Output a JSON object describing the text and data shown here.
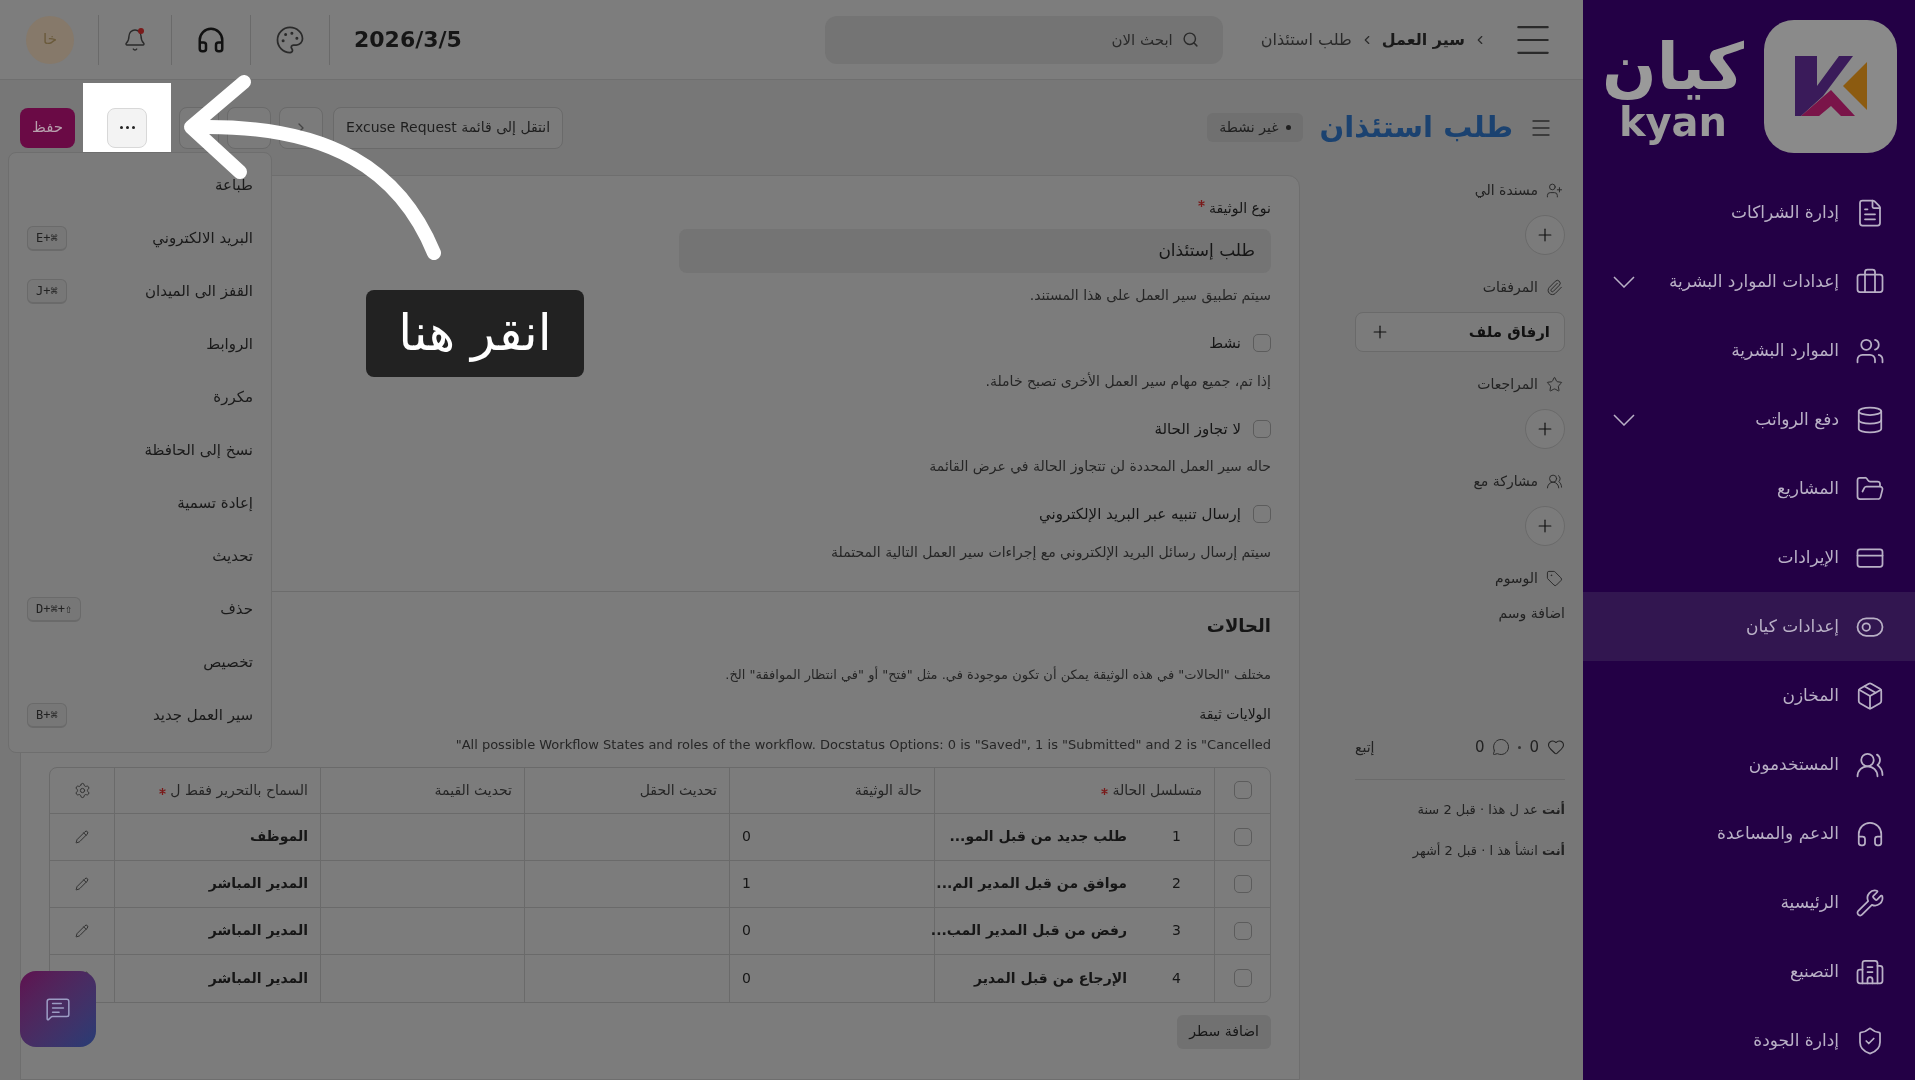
{
  "sidebar": {
    "logo_text": "كيان",
    "logo_latin": "kyan",
    "items": [
      {
        "label": "إدارة الشراكات",
        "expandable": false,
        "selected": false
      },
      {
        "label": "إعدادات الموارد البشرية",
        "expandable": true,
        "selected": false
      },
      {
        "label": "الموارد البشرية",
        "expandable": false,
        "selected": false
      },
      {
        "label": "دفع الرواتب",
        "expandable": true,
        "selected": false
      },
      {
        "label": "المشاريع",
        "expandable": false,
        "selected": false
      },
      {
        "label": "الإيرادات",
        "expandable": false,
        "selected": false
      },
      {
        "label": "إعدادات كيان",
        "expandable": false,
        "selected": true
      },
      {
        "label": "المخازن",
        "expandable": false,
        "selected": false
      },
      {
        "label": "المستخدمون",
        "expandable": false,
        "selected": false
      },
      {
        "label": "الدعم والمساعدة",
        "expandable": false,
        "selected": false
      },
      {
        "label": "الرئيسية",
        "expandable": false,
        "selected": false
      },
      {
        "label": "التصنيع",
        "expandable": false,
        "selected": false
      },
      {
        "label": "إدارة الجودة",
        "expandable": false,
        "selected": false
      }
    ]
  },
  "top_bar": {
    "breadcrumb": [
      "سير العمل",
      "طلب استئذان"
    ],
    "search": {
      "placeholder": "ابحث الان"
    },
    "date": "2026/3/5",
    "has_unread": true,
    "avatar": "خا"
  },
  "header": {
    "title": "طلب استئذان",
    "status": "غير نشطة",
    "list_button": "انتقل إلى قائمة Excuse Request",
    "save_button": "حفظ"
  },
  "menu": [
    {
      "label": "طباعة"
    },
    {
      "label": "البريد الالكتروني",
      "shortcut": "E+⌘"
    },
    {
      "label": "القفز الى الميدان",
      "shortcut": "J+⌘"
    },
    {
      "label": "الروابط"
    },
    {
      "label": "مكررة"
    },
    {
      "label": "نسخ إلى الحافظة"
    },
    {
      "label": "إعادة تسمية"
    },
    {
      "label": "تحديث"
    },
    {
      "label": "حذف",
      "shortcut": "D+⌘+⇧"
    },
    {
      "label": "تخصيص"
    },
    {
      "label": "سير العمل جديد",
      "shortcut": "B+⌘"
    }
  ],
  "form": {
    "doc_type": {
      "label": "نوع الوثيقة",
      "required": true,
      "value": "طلب إستئذان",
      "help": "سيتم تطبيق سير العمل على هذا المستند."
    },
    "checks": [
      {
        "label": "نشط",
        "checked": false,
        "help": "إذا تم، جميع مهام سير العمل الأخرى تصبح خاملة."
      },
      {
        "label": "لا تجاوز الحالة",
        "checked": false,
        "help": "حاله سير العمل المحددة لن تتجاوز الحالة في عرض القائمة"
      },
      {
        "label": "إرسال تنبيه عبر البريد الإلكتروني",
        "checked": false,
        "help": "سيتم إرسال رسائل البريد الإلكتروني مع إجراءات سير العمل التالية المحتملة"
      }
    ]
  },
  "states": {
    "title": "الحالات",
    "description": "مختلف \"الحالات\" في هذه الوثيقة يمكن أن تكون موجودة في. مثل \"فتح\" أو \"في انتظار الموافقة\" الخ.",
    "subtitle": "الولايات ثيقة",
    "note": "All possible Workflow States and roles of the workflow. Docstatus Options: 0 is \"Saved\", 1 is \"Submitted\" and 2 is \"Cancelled\"",
    "table": {
      "all_selected": false,
      "columns": [
        {
          "label": "متسلسل الحالة",
          "required": true
        },
        {
          "label": "حالة الوثيقة",
          "required": false
        },
        {
          "label": "تحديث الحقل",
          "required": false
        },
        {
          "label": "تحديث القيمة",
          "required": false
        },
        {
          "label": "السماح بالتحرير فقط ل",
          "required": true
        }
      ],
      "rows": [
        {
          "index": "1",
          "state": "طلب جديد من قبل المو...",
          "doc_status": "0",
          "role": "الموظف",
          "selected": false
        },
        {
          "index": "2",
          "state": "موافق من قبل المدير الم...",
          "doc_status": "1",
          "role": "المدير المباشر",
          "selected": false
        },
        {
          "index": "3",
          "state": "رفض من قبل المدير المب...",
          "doc_status": "0",
          "role": "المدير المباشر",
          "selected": false
        },
        {
          "index": "4",
          "state": "الإرجاع من قبل المدير",
          "doc_status": "0",
          "role": "المدير المباشر",
          "selected": false
        }
      ]
    },
    "add_row": "اضافة سطر"
  },
  "side_panel": {
    "sections": [
      {
        "kind": "add",
        "label": "مسندة الي"
      },
      {
        "kind": "attach",
        "label": "المرفقات",
        "action": "ارفاق ملف"
      },
      {
        "kind": "add",
        "label": "المراجعات"
      },
      {
        "kind": "add",
        "label": "مشاركة مع"
      },
      {
        "kind": "tags",
        "label": "الوسوم",
        "action": "اضافة وسم"
      }
    ],
    "likes": "0",
    "comments": "0",
    "follow": "إتبع",
    "activity": [
      "**أنت** عد ل هذا · قبل 2 سنة",
      "**أنت** انشأ هذ ا · قبل 2 أشهر"
    ]
  },
  "tutorial": {
    "hint": "انقر هنا"
  }
}
